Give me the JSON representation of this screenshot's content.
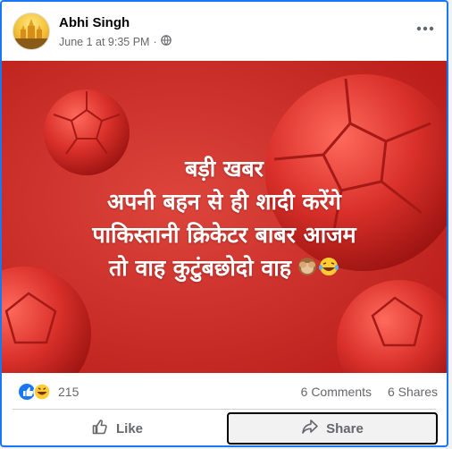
{
  "post": {
    "author": "Abhi Singh",
    "timestamp": "June 1 at 9:35 PM",
    "meta_separator": "·",
    "privacy_icon": "globe-icon",
    "more_icon": "more-options-icon"
  },
  "image": {
    "background_color": "#cf2d27",
    "lines": [
      "बड़ी खबर",
      "अपनी बहन से ही शादी करेंगे",
      "पाकिस्तानी क्रिकेटर बाबर आजम",
      "तो वाह कुटुंबछोदो वाह"
    ],
    "emojis": [
      "see-no-evil-monkey-icon",
      "laughing-tears-icon"
    ]
  },
  "stats": {
    "reaction_icons": [
      "like-reaction-icon",
      "haha-reaction-icon"
    ],
    "reaction_count": "215",
    "comments": "6 Comments",
    "shares": "6 Shares"
  },
  "actions": {
    "like_label": "Like",
    "share_label": "Share"
  },
  "colors": {
    "brand_blue": "#1877f2",
    "secondary_text": "#65676b"
  }
}
